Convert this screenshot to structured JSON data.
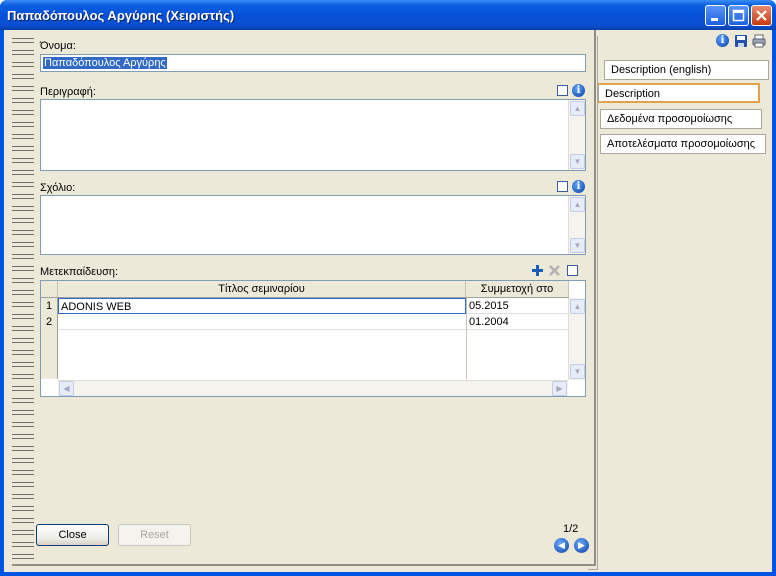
{
  "window": {
    "title": "Παπαδόπουλος Αργύρης (Χειριστής)"
  },
  "form": {
    "name_label": "Όνομα:",
    "name_value": "Παπαδόπουλος Αργύρης",
    "description_label": "Περιγραφή:",
    "comment_label": "Σχόλιο:",
    "training_label": "Μετεκπαίδευση:",
    "grid": {
      "columns": [
        "Τίτλος σεμιναρίου",
        "Συμμετοχή στο"
      ],
      "rows": [
        {
          "num": "1",
          "title": "ADONIS WEB",
          "date": "05.2015"
        },
        {
          "num": "2",
          "title": "",
          "date": "01.2004"
        }
      ]
    }
  },
  "footer": {
    "close_label": "Close",
    "reset_label": "Reset",
    "page_indicator": "1/2"
  },
  "side_tabs": [
    {
      "label": "Description (english)",
      "active": false
    },
    {
      "label": "Description",
      "active": true
    },
    {
      "label": "Δεδομένα προσομοίωσης",
      "active": false
    },
    {
      "label": "Αποτελέσματα προσομοίωσης",
      "active": false
    }
  ],
  "colors": {
    "titlebar": "#0650d8",
    "client": "#ece9d8",
    "selection": "#316ac5",
    "active_tab_border": "#e0a34a"
  },
  "icons": [
    "info-icon",
    "save-icon",
    "print-icon",
    "add-icon",
    "delete-icon",
    "minimize-icon",
    "maximize-icon",
    "close-icon"
  ]
}
